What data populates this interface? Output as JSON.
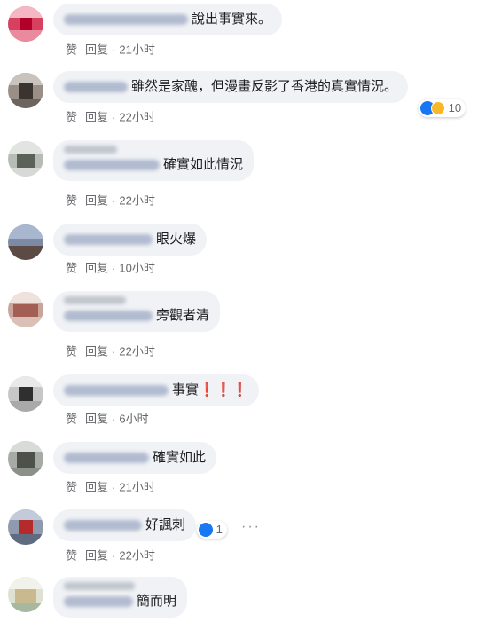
{
  "labels": {
    "like": "赞",
    "reply": "回复",
    "dot": "·"
  },
  "comments": [
    {
      "name": "Hanting Kan",
      "text": "說出事實來。",
      "time": "21小时"
    },
    {
      "name": "Dom Kai",
      "text": "雖然是家醜，但漫畫反影了香港的真實情況。",
      "time": "22小时",
      "reactions": "10"
    },
    {
      "name": "Wing Leung",
      "text": "確實如此情況",
      "time": "22小时"
    },
    {
      "name": "Mike Chui",
      "text": "眼火爆",
      "time": "10小时"
    },
    {
      "name": "Wong Amy",
      "text": "旁觀者清",
      "time": "22小时"
    },
    {
      "name": "Johnnya ng",
      "text": "事實",
      "exclaims": "❗❗❗",
      "time": "6小时"
    },
    {
      "name": "Li Shing",
      "text": "確實如此",
      "time": "21小时"
    },
    {
      "name": "Chan Lee",
      "text": "好諷刺",
      "time": "22小时",
      "reactions": "1"
    },
    {
      "name": "Kit Wong",
      "text": "簡而明"
    }
  ]
}
